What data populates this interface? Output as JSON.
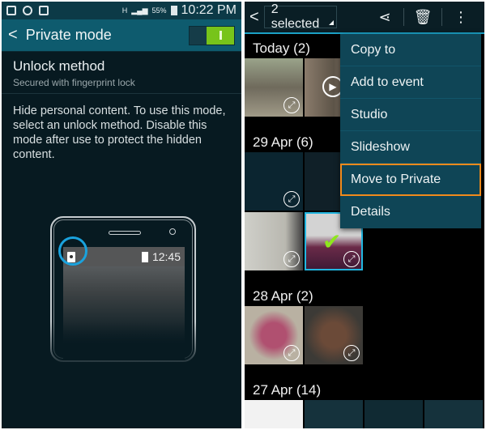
{
  "left": {
    "statusbar": {
      "icons": [
        "private-mode-icon",
        "whatsapp-icon",
        "gallery-icon"
      ],
      "network": "H",
      "battery": "55%",
      "time": "10:22 PM"
    },
    "actionbar": {
      "back_glyph": "<",
      "title": "Private mode",
      "toggle_state": "on"
    },
    "unlock_method": {
      "title": "Unlock method",
      "subtitle": "Secured with fingerprint lock"
    },
    "description": "Hide personal content. To use this mode, select an unlock method. Disable this mode after use to protect the hidden content.",
    "illustration": {
      "time": "12:45"
    }
  },
  "right": {
    "actionbar": {
      "back_glyph": "<",
      "selected_label": "2 selected"
    },
    "groups": [
      {
        "title": "Today (2)"
      },
      {
        "title": "29 Apr (6)"
      },
      {
        "title": "28 Apr (2)"
      },
      {
        "title": "27 Apr (14)"
      }
    ],
    "menu": [
      {
        "label": "Copy to"
      },
      {
        "label": "Add to event"
      },
      {
        "label": "Studio"
      },
      {
        "label": "Slideshow"
      },
      {
        "label": "Move to Private",
        "highlighted": true
      },
      {
        "label": "Details"
      }
    ]
  },
  "colors": {
    "accent": "#1ba1c6",
    "toggle_on": "#77c41a",
    "highlight": "#f08a1c",
    "check": "#8ee61d"
  }
}
